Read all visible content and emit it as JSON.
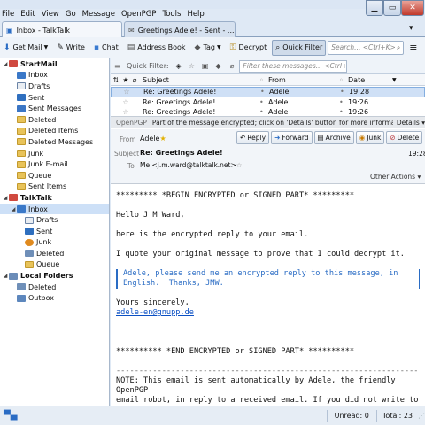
{
  "window": {
    "min_glyph": "▁",
    "max_glyph": "▭",
    "close_glyph": "✕"
  },
  "menubar": [
    "File",
    "Edit",
    "View",
    "Go",
    "Message",
    "OpenPGP",
    "Tools",
    "Help"
  ],
  "tabs": [
    {
      "label": "Inbox - TalkTalk",
      "active": true
    },
    {
      "label": "Greetings Adele! - Sent - ...",
      "active": false,
      "close": "✕"
    }
  ],
  "toolbar": {
    "get_mail": "Get Mail",
    "write": "Write",
    "chat": "Chat",
    "address_book": "Address Book",
    "tag": "Tag",
    "decrypt": "Decrypt",
    "quick_filter": "Quick Filter",
    "search_placeholder": "Search... <Ctrl+K>"
  },
  "folders": [
    {
      "label": "StartMail",
      "type": "account",
      "indent": 0,
      "twisty": "◢",
      "icon": "account"
    },
    {
      "label": "Inbox",
      "indent": 1,
      "icon": "inbox"
    },
    {
      "label": "Drafts",
      "indent": 1,
      "icon": "drafts"
    },
    {
      "label": "Sent",
      "indent": 1,
      "icon": "sent"
    },
    {
      "label": "Sent Messages",
      "indent": 1,
      "icon": "folder-blue"
    },
    {
      "label": "Deleted",
      "indent": 1,
      "icon": "folder"
    },
    {
      "label": "Deleted Items",
      "indent": 1,
      "icon": "folder"
    },
    {
      "label": "Deleted Messages",
      "indent": 1,
      "icon": "folder"
    },
    {
      "label": "Junk",
      "indent": 1,
      "icon": "folder"
    },
    {
      "label": "Junk E-mail",
      "indent": 1,
      "icon": "folder"
    },
    {
      "label": "Queue",
      "indent": 1,
      "icon": "folder"
    },
    {
      "label": "Sent Items",
      "indent": 1,
      "icon": "folder"
    },
    {
      "label": "TalkTalk",
      "type": "account",
      "indent": 0,
      "twisty": "◢",
      "icon": "account"
    },
    {
      "label": "Inbox",
      "indent": 1,
      "icon": "inbox",
      "selected": true,
      "twisty": "◢"
    },
    {
      "label": "Drafts",
      "indent": 2,
      "icon": "drafts"
    },
    {
      "label": "Sent",
      "indent": 2,
      "icon": "sent"
    },
    {
      "label": "Junk",
      "indent": 2,
      "icon": "junk"
    },
    {
      "label": "Deleted",
      "indent": 2,
      "icon": "trash"
    },
    {
      "label": "Queue",
      "indent": 2,
      "icon": "folder"
    },
    {
      "label": "Local Folders",
      "type": "account",
      "indent": 0,
      "twisty": "◢",
      "icon": "local"
    },
    {
      "label": "Deleted",
      "indent": 1,
      "icon": "trash"
    },
    {
      "label": "Outbox",
      "indent": 1,
      "icon": "outbox"
    }
  ],
  "quick_filter": {
    "label": "Quick Filter:",
    "placeholder": "Filter these messages... <Ctrl+Shift+K>"
  },
  "columns": {
    "subject": "Subject",
    "from": "From",
    "date": "Date"
  },
  "messages": [
    {
      "subject": "Re: Greetings Adele!",
      "from": "Adele",
      "date": "19:28",
      "selected": true
    },
    {
      "subject": "Re: Greetings Adele!",
      "from": "Adele",
      "date": "19:26"
    },
    {
      "subject": "Re: Greetings Adele!",
      "from": "Adele",
      "date": "19:26"
    }
  ],
  "openpgp_bar": {
    "label": "OpenPGP",
    "text": "Part of the message encrypted; click on 'Details' button for more information",
    "details": "Details"
  },
  "header": {
    "from_label": "From",
    "from_value": "Adele",
    "reply": "Reply",
    "forward": "Forward",
    "archive": "Archive",
    "junk": "Junk",
    "delete": "Delete",
    "subject_label": "Subject",
    "subject_value": "Re: Greetings Adele!",
    "time": "19:28",
    "to_label": "To",
    "to_value": "Me <j.m.ward@talktalk.net>",
    "other_actions": "Other Actions"
  },
  "body": {
    "begin": "********* *BEGIN ENCRYPTED or SIGNED PART* *********",
    "greeting": "Hello J M Ward,",
    "line1": "here is the encrypted reply to your email.",
    "line2": "I quote your original message to prove that I could decrypt it.",
    "quote": "Adele, please send me an encrypted reply to this message, in\nEnglish.  Thanks, JMW.",
    "sign1": "Yours sincerely,",
    "sign_link": "adele-en@gnupp.de",
    "end": "********** *END ENCRYPTED or SIGNED PART* **********",
    "divider": "------------------------------------------------------------------",
    "note": "NOTE: This email is sent automatically by Adele, the friendly\nOpenPGP\nemail robot, in reply to a received email. If you did not write to"
  },
  "status": {
    "unread": "Unread: 0",
    "total": "Total: 23"
  },
  "colors": {
    "accent": "#2a6cc4",
    "selection": "#cde0f7",
    "folder": "#e8c35a"
  }
}
